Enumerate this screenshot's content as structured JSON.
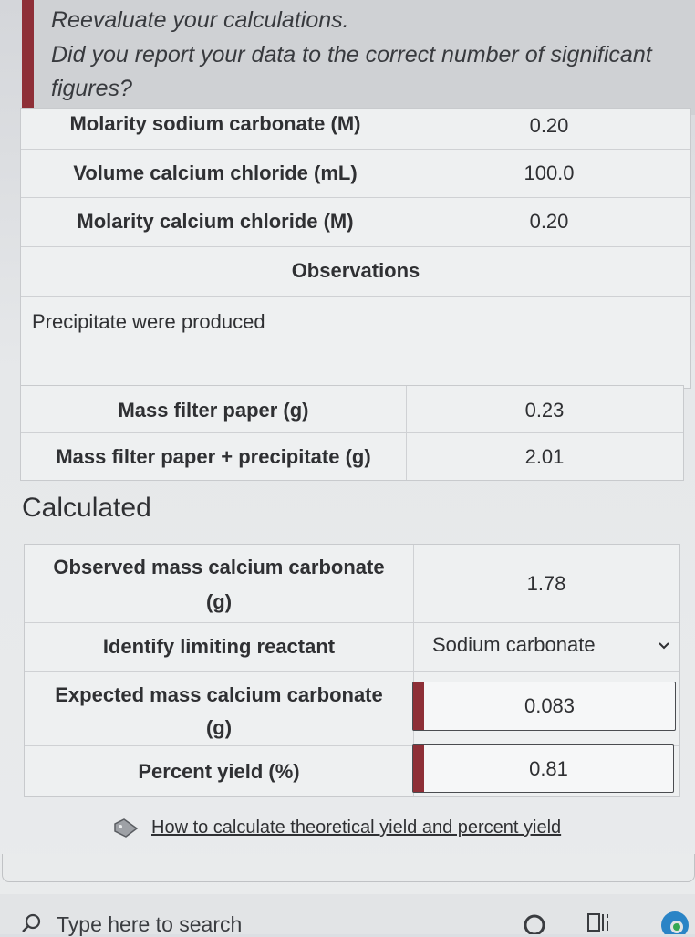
{
  "feedback": {
    "line1": "Reevaluate your calculations.",
    "line2": "Did you report your data to the correct number of significant",
    "line3": "figures?"
  },
  "data_table": {
    "rows": [
      {
        "label": "Molarity sodium carbonate (M)",
        "value": "0.20"
      },
      {
        "label": "Volume calcium chloride (mL)",
        "value": "100.0"
      },
      {
        "label": "Molarity calcium chloride (M)",
        "value": "0.20"
      }
    ],
    "observations_header": "Observations",
    "observations_text": "Precipitate were produced"
  },
  "mass_table": {
    "rows": [
      {
        "label": "Mass filter paper (g)",
        "value": "0.23"
      },
      {
        "label": "Mass filter paper + precipitate (g)",
        "value": "2.01"
      }
    ]
  },
  "calculated": {
    "title": "Calculated",
    "observed_mass_label_1": "Observed mass calcium carbonate",
    "observed_mass_label_2": "(g)",
    "observed_mass_value": "1.78",
    "limiting_label": "Identify limiting reactant",
    "limiting_value": "Sodium carbonate",
    "expected_mass_label_1": "Expected mass calcium carbonate",
    "expected_mass_label_2": "(g)",
    "expected_mass_value": "0.083",
    "percent_yield_label": "Percent yield (%)",
    "percent_yield_value": "0.81"
  },
  "hint_link": "How to calculate theoretical yield and percent yield",
  "taskbar": {
    "search_placeholder": "Type here to search"
  },
  "colors": {
    "error_flag": "#8e2f37",
    "edge_blue": "#2a84c6"
  },
  "icons": [
    "search-icon",
    "chevron-down-icon",
    "hint-tag-icon",
    "cortana-icon",
    "task-view-icon",
    "edge-icon"
  ]
}
